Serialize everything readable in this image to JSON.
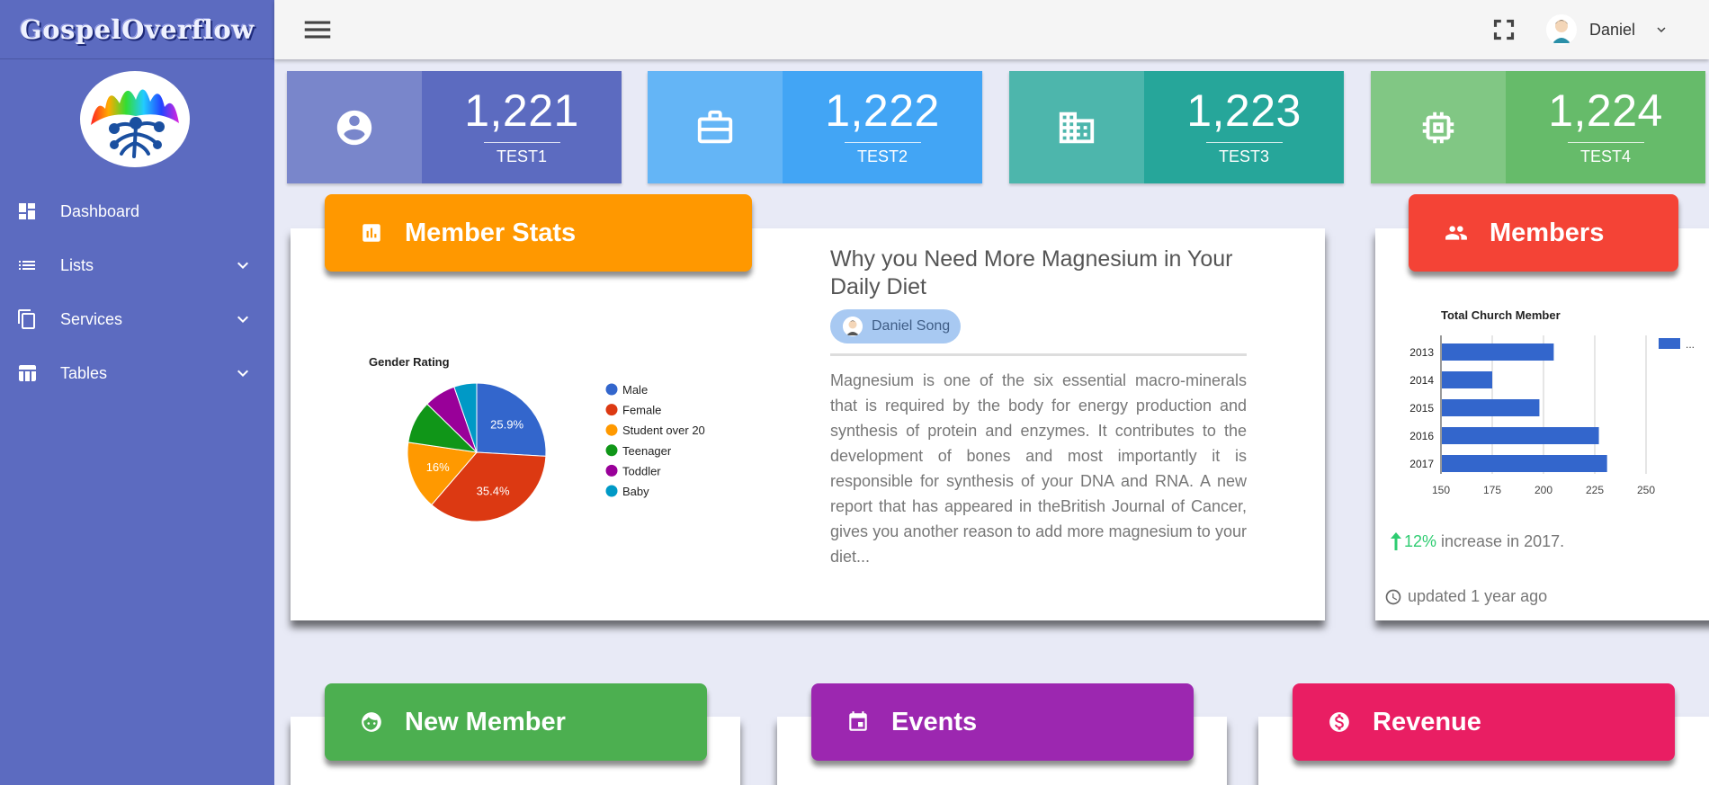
{
  "brand": {
    "title": "GospelOverflow"
  },
  "sidebar": {
    "items": [
      {
        "label": "Dashboard",
        "icon": "dashboard-icon",
        "expandable": false
      },
      {
        "label": "Lists",
        "icon": "list-icon",
        "expandable": true
      },
      {
        "label": "Services",
        "icon": "copy-icon",
        "expandable": true
      },
      {
        "label": "Tables",
        "icon": "table-icon",
        "expandable": true
      }
    ]
  },
  "topbar": {
    "user_name": "Daniel"
  },
  "tiles": [
    {
      "value": "1,221",
      "label": "TEST1",
      "icon": "account-circle-icon",
      "color_light": "#7986cb",
      "color_dark": "#5c6bc0"
    },
    {
      "value": "1,222",
      "label": "TEST2",
      "icon": "briefcase-icon",
      "color_light": "#64b5f6",
      "color_dark": "#42a5f5"
    },
    {
      "value": "1,223",
      "label": "TEST3",
      "icon": "building-icon",
      "color_light": "#4db6ac",
      "color_dark": "#26a69a"
    },
    {
      "value": "1,224",
      "label": "TEST4",
      "icon": "chip-icon",
      "color_light": "#81c784",
      "color_dark": "#66bb6a"
    }
  ],
  "member_stats": {
    "header": "Member Stats",
    "header_color": "#ff9800"
  },
  "article": {
    "title": "Why you Need More Magnesium in Your Daily Diet",
    "author": "Daniel Song",
    "body": "Magnesium is one of the six essential macro-minerals that is required by the body for energy production and synthesis of protein and enzymes. It contributes to the development of bones and most importantly it is responsible for synthesis of your DNA and RNA. A new report that has appeared in theBritish Journal of Cancer, gives you another reason to add more magnesium to your diet..."
  },
  "members": {
    "header": "Members",
    "header_color": "#f44336",
    "increase_pct": "12%",
    "increase_text": "increase in 2017.",
    "updated": "updated 1 year ago"
  },
  "bottom_cards": [
    {
      "header": "New Member",
      "color": "#4caf50",
      "icon": "baby-face-icon"
    },
    {
      "header": "Events",
      "color": "#9c27b0",
      "icon": "calendar-icon"
    },
    {
      "header": "Revenue",
      "color": "#e91e63",
      "icon": "dollar-icon"
    }
  ],
  "chart_data": [
    {
      "type": "pie",
      "title": "Gender Rating",
      "categories": [
        "Male",
        "Female",
        "Student over 20",
        "Teenager",
        "Toddler",
        "Baby"
      ],
      "values": [
        25.9,
        35.4,
        16,
        10,
        7.4,
        5.3
      ],
      "slice_labels": [
        "25.9%",
        "35.4%",
        "16%",
        "",
        "",
        ""
      ],
      "colors": [
        "#3366cc",
        "#dc3912",
        "#ff9900",
        "#109618",
        "#990099",
        "#0099c6"
      ],
      "legend": "right"
    },
    {
      "type": "bar",
      "orientation": "horizontal",
      "title": "Total Church Member",
      "categories": [
        "2013",
        "2014",
        "2015",
        "2016",
        "2017"
      ],
      "values": [
        205,
        175,
        198,
        227,
        231
      ],
      "xlim": [
        150,
        250
      ],
      "ticks": [
        "150",
        "175",
        "200",
        "225",
        "250"
      ],
      "color": "#3366cc",
      "legend_label": "...",
      "grid": true
    }
  ]
}
